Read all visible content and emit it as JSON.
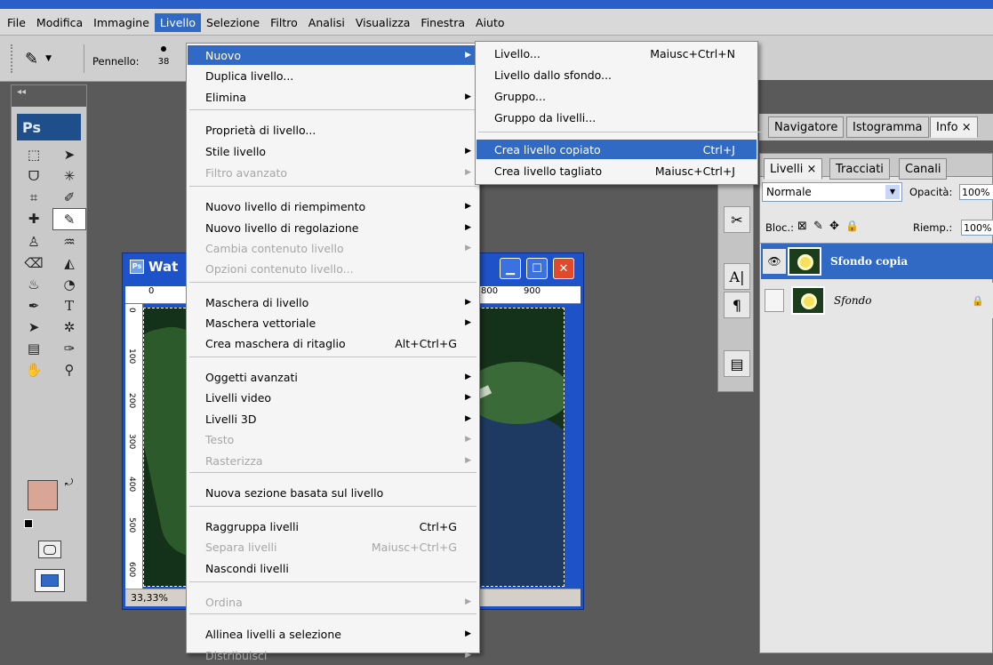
{
  "menubar": {
    "items": [
      "File",
      "Modifica",
      "Immagine",
      "Livello",
      "Selezione",
      "Filtro",
      "Analisi",
      "Visualizza",
      "Finestra",
      "Aiuto"
    ],
    "active_index": 3
  },
  "options_bar": {
    "brush_label": "Pennello:",
    "brush_size": "38"
  },
  "toolbox": {
    "collapse": "◂◂",
    "logo": "Ps"
  },
  "document": {
    "title": "Wat",
    "ruler_top": [
      "0",
      "800",
      "900"
    ],
    "ruler_left": [
      "0",
      "100",
      "200",
      "300",
      "400",
      "500",
      "600"
    ],
    "zoom": "33,33%"
  },
  "layer_menu": {
    "items": [
      {
        "label": "Nuovo",
        "shortcut": "",
        "submenu": true,
        "state": "highlighted"
      },
      {
        "label": "Duplica livello...",
        "shortcut": "",
        "submenu": false,
        "state": "normal"
      },
      {
        "label": "Elimina",
        "shortcut": "",
        "submenu": true,
        "state": "normal"
      },
      {
        "label": "Proprietà di livello...",
        "shortcut": "",
        "submenu": false,
        "state": "normal"
      },
      {
        "label": "Stile livello",
        "shortcut": "",
        "submenu": true,
        "state": "normal"
      },
      {
        "label": "Filtro avanzato",
        "shortcut": "",
        "submenu": true,
        "state": "disabled"
      },
      {
        "label": "Nuovo livello di riempimento",
        "shortcut": "",
        "submenu": true,
        "state": "normal"
      },
      {
        "label": "Nuovo livello di regolazione",
        "shortcut": "",
        "submenu": true,
        "state": "normal"
      },
      {
        "label": "Cambia contenuto livello",
        "shortcut": "",
        "submenu": true,
        "state": "disabled"
      },
      {
        "label": "Opzioni contenuto livello...",
        "shortcut": "",
        "submenu": false,
        "state": "disabled"
      },
      {
        "label": "Maschera di livello",
        "shortcut": "",
        "submenu": true,
        "state": "normal"
      },
      {
        "label": "Maschera vettoriale",
        "shortcut": "",
        "submenu": true,
        "state": "normal"
      },
      {
        "label": "Crea maschera di ritaglio",
        "shortcut": "Alt+Ctrl+G",
        "submenu": false,
        "state": "normal"
      },
      {
        "label": "Oggetti avanzati",
        "shortcut": "",
        "submenu": true,
        "state": "normal"
      },
      {
        "label": "Livelli video",
        "shortcut": "",
        "submenu": true,
        "state": "normal"
      },
      {
        "label": "Livelli 3D",
        "shortcut": "",
        "submenu": true,
        "state": "normal"
      },
      {
        "label": "Testo",
        "shortcut": "",
        "submenu": true,
        "state": "disabled"
      },
      {
        "label": "Rasterizza",
        "shortcut": "",
        "submenu": true,
        "state": "disabled"
      },
      {
        "label": "Nuova sezione basata sul livello",
        "shortcut": "",
        "submenu": false,
        "state": "normal"
      },
      {
        "label": "Raggruppa livelli",
        "shortcut": "Ctrl+G",
        "submenu": false,
        "state": "normal"
      },
      {
        "label": "Separa livelli",
        "shortcut": "Maiusc+Ctrl+G",
        "submenu": false,
        "state": "disabled"
      },
      {
        "label": "Nascondi livelli",
        "shortcut": "",
        "submenu": false,
        "state": "normal"
      },
      {
        "label": "Ordina",
        "shortcut": "",
        "submenu": true,
        "state": "disabled"
      },
      {
        "label": "Allinea livelli a selezione",
        "shortcut": "",
        "submenu": true,
        "state": "normal"
      },
      {
        "label": "Distribuisci",
        "shortcut": "",
        "submenu": true,
        "state": "disabled"
      }
    ]
  },
  "new_submenu": {
    "items": [
      {
        "label": "Livello...",
        "shortcut": "Maiusc+Ctrl+N",
        "state": "normal"
      },
      {
        "label": "Livello dallo sfondo...",
        "shortcut": "",
        "state": "normal"
      },
      {
        "label": "Gruppo...",
        "shortcut": "",
        "state": "normal"
      },
      {
        "label": "Gruppo da livelli...",
        "shortcut": "",
        "state": "normal"
      },
      {
        "label": "Crea livello copiato",
        "shortcut": "Ctrl+J",
        "state": "highlighted"
      },
      {
        "label": "Crea livello tagliato",
        "shortcut": "Maiusc+Ctrl+J",
        "state": "normal"
      }
    ]
  },
  "panels": {
    "top_tabs": [
      "Navigatore",
      "Istogramma",
      "Info ×"
    ],
    "layer_tabs": [
      "Livelli ×",
      "Tracciati",
      "Canali"
    ],
    "blend_mode": "Normale",
    "opacity_label": "Opacità:",
    "opacity_value": "100%",
    "lock_label": "Bloc.:",
    "fill_label": "Riemp.:",
    "fill_value": "100%",
    "layers": [
      {
        "name": "Sfondo copia",
        "selected": true
      },
      {
        "name": "Sfondo",
        "selected": false
      }
    ]
  },
  "colors": {
    "menu_highlight": "#316ac5",
    "foreground": "#d9a597",
    "xp_title": "#1e52c8"
  }
}
